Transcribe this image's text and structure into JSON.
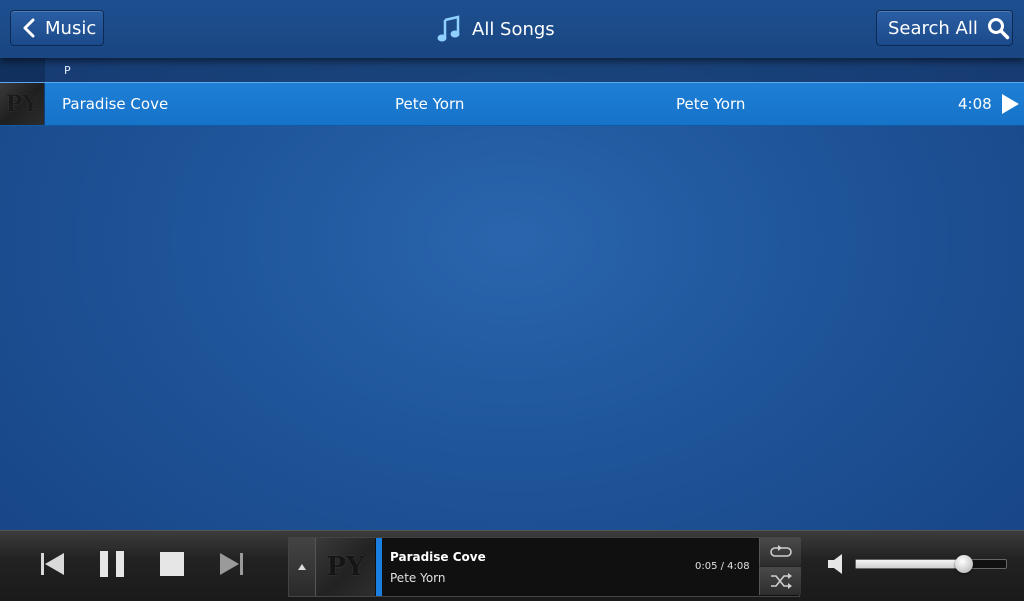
{
  "header": {
    "back_label": "Music",
    "title": "All Songs",
    "search_label": "Search All"
  },
  "list": {
    "section_letter": "P",
    "songs": [
      {
        "art_text": "PY",
        "title": "Paradise Cove",
        "artist": "Pete Yorn",
        "album": "Pete Yorn",
        "duration": "4:08"
      }
    ]
  },
  "now_playing": {
    "art_text": "PY",
    "title": "Paradise Cove",
    "artist": "Pete Yorn",
    "time": "0:05 / 4:08"
  },
  "volume": {
    "level": 0.72
  },
  "colors": {
    "accent": "#1a7fe0",
    "selected_row": "#1e7fd6",
    "background": "#1e5499"
  },
  "icons": [
    "chevron-left-icon",
    "music-note-icon",
    "search-icon",
    "play-icon",
    "skip-previous-icon",
    "pause-icon",
    "stop-icon",
    "skip-next-icon",
    "expand-up-icon",
    "repeat-icon",
    "shuffle-icon",
    "speaker-icon"
  ]
}
